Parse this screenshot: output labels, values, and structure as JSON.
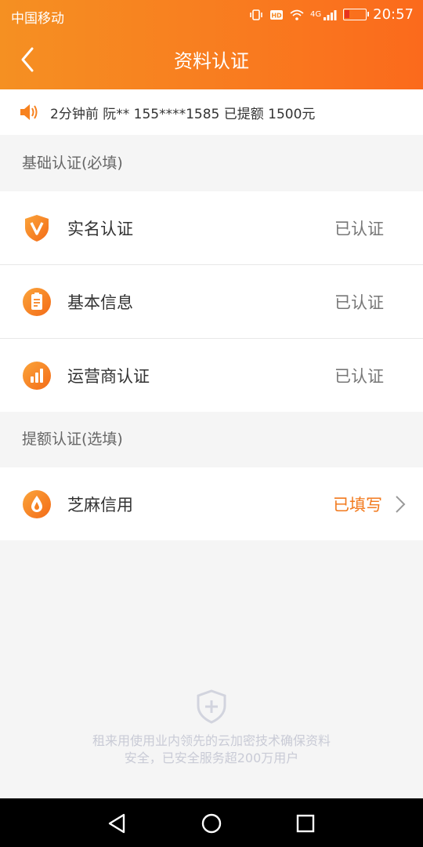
{
  "status_bar": {
    "carrier": "中国移动",
    "network": "4G",
    "time": "20:57"
  },
  "nav": {
    "title": "资料认证"
  },
  "notice": {
    "text": "2分钟前 阮** 155****1585 已提额 1500元"
  },
  "sections": [
    {
      "title": "基础认证(必填)",
      "items": [
        {
          "label": "实名认证",
          "status": "已认证",
          "icon": "shield-v-icon"
        },
        {
          "label": "基本信息",
          "status": "已认证",
          "icon": "clipboard-icon"
        },
        {
          "label": "运营商认证",
          "status": "已认证",
          "icon": "bar-chart-icon"
        }
      ]
    },
    {
      "title": "提额认证(选填)",
      "items": [
        {
          "label": "芝麻信用",
          "status": "已填写",
          "icon": "sesame-drop-icon"
        }
      ]
    }
  ],
  "footer": {
    "line1": "租来用使用业内领先的云加密技术确保资料",
    "line2": "安全，已安全服务超200万用户"
  },
  "colors": {
    "accent": "#f97a1f",
    "filled_status": "#f27a1e"
  }
}
